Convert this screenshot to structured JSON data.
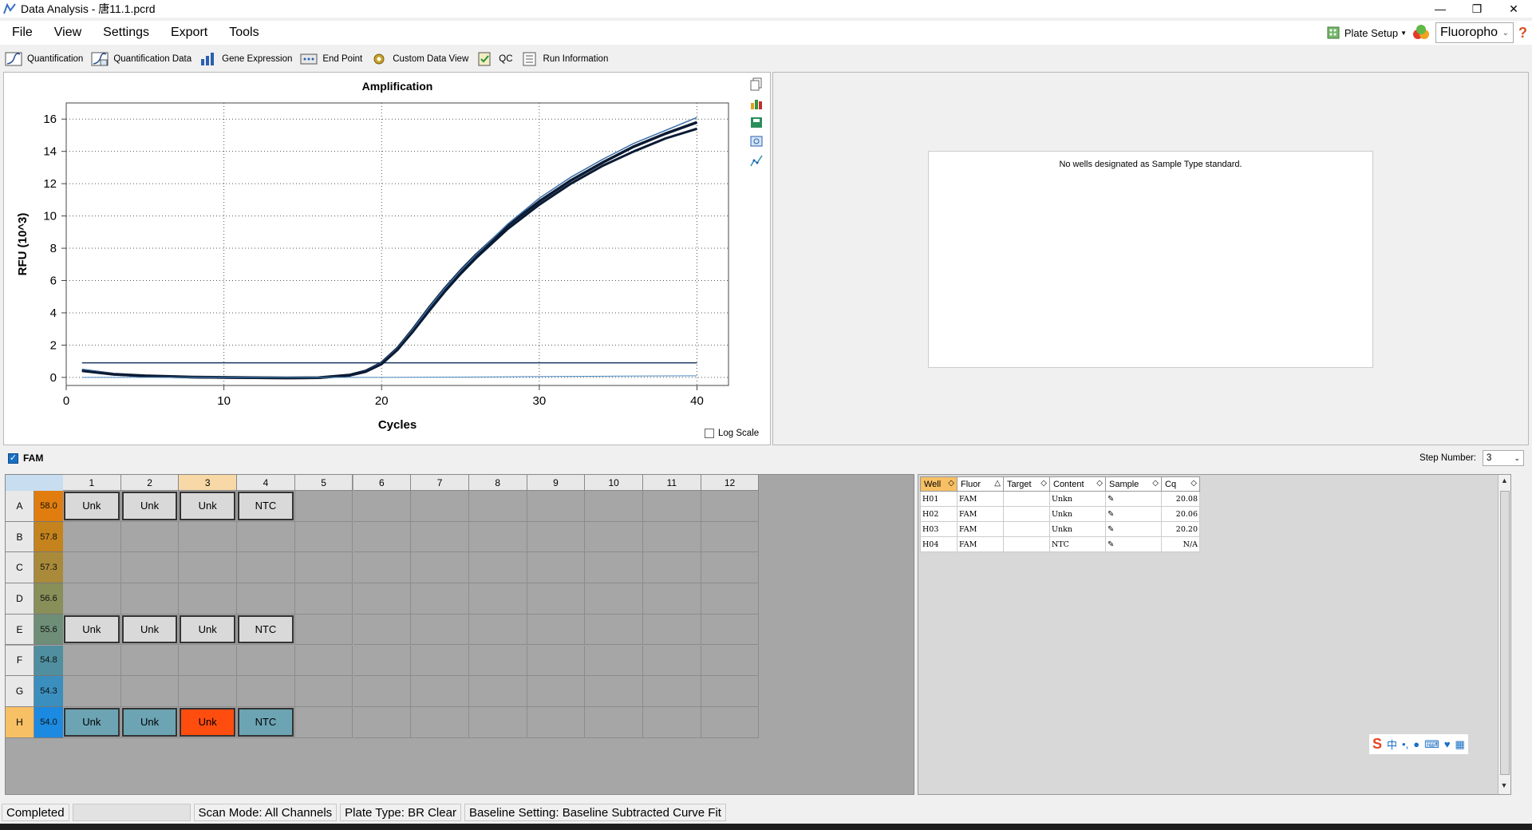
{
  "window": {
    "title": "Data Analysis - 唐11.1.pcrd"
  },
  "menu": {
    "items": [
      "File",
      "View",
      "Settings",
      "Export",
      "Tools"
    ],
    "plate_setup": "Plate Setup",
    "fluorophore": "Fluoropho"
  },
  "toolbar": {
    "tabs": [
      "Quantification",
      "Quantification Data",
      "Gene Expression",
      "End Point",
      "Custom Data View",
      "QC",
      "Run Information"
    ],
    "active": "Quantification"
  },
  "chart_data": {
    "type": "line",
    "title": "Amplification",
    "xlabel": "Cycles",
    "ylabel": "RFU (10^3)",
    "xlim": [
      0,
      42
    ],
    "ylim": [
      -0.5,
      17
    ],
    "xticks": [
      0,
      10,
      20,
      30,
      40
    ],
    "yticks": [
      0,
      2,
      4,
      6,
      8,
      10,
      12,
      14,
      16
    ],
    "grid": true,
    "threshold": 0.9,
    "series": [
      {
        "well": "H01",
        "x": [
          1,
          3,
          5,
          8,
          10,
          12,
          14,
          16,
          18,
          19,
          20,
          21,
          22,
          23,
          24,
          25,
          26,
          28,
          30,
          32,
          34,
          36,
          38,
          40
        ],
        "y": [
          0.45,
          0.2,
          0.1,
          0.02,
          0,
          -0.02,
          -0.03,
          -0.02,
          0.15,
          0.4,
          0.9,
          1.8,
          3.0,
          4.3,
          5.5,
          6.6,
          7.6,
          9.4,
          10.9,
          12.2,
          13.3,
          14.3,
          15.1,
          15.8
        ]
      },
      {
        "well": "H02",
        "x": [
          1,
          3,
          5,
          8,
          10,
          12,
          14,
          16,
          18,
          19,
          20,
          21,
          22,
          23,
          24,
          25,
          26,
          28,
          30,
          32,
          34,
          36,
          38,
          40
        ],
        "y": [
          0.5,
          0.22,
          0.1,
          0.02,
          0,
          -0.02,
          -0.03,
          -0.02,
          0.15,
          0.4,
          0.9,
          1.8,
          3.0,
          4.3,
          5.5,
          6.6,
          7.6,
          9.5,
          11.1,
          12.4,
          13.5,
          14.5,
          15.3,
          16.1
        ]
      },
      {
        "well": "H03",
        "x": [
          1,
          3,
          5,
          8,
          10,
          12,
          14,
          16,
          18,
          19,
          20,
          21,
          22,
          23,
          24,
          25,
          26,
          28,
          30,
          32,
          34,
          36,
          38,
          40
        ],
        "y": [
          0.4,
          0.18,
          0.08,
          0.01,
          -0.01,
          -0.03,
          -0.04,
          -0.03,
          0.12,
          0.35,
          0.82,
          1.7,
          2.85,
          4.1,
          5.3,
          6.4,
          7.4,
          9.2,
          10.7,
          12.0,
          13.1,
          14.0,
          14.8,
          15.4
        ]
      },
      {
        "well": "H04",
        "x": [
          1,
          10,
          20,
          25,
          30,
          35,
          40
        ],
        "y": [
          0,
          0,
          0,
          0.02,
          0.05,
          0.08,
          0.1
        ]
      }
    ]
  },
  "log_scale": "Log Scale",
  "standard": {
    "message": "No wells designated as Sample Type standard."
  },
  "fam": {
    "label": "FAM",
    "step_label": "Step Number:",
    "step_value": "3"
  },
  "plate": {
    "columns": [
      "1",
      "2",
      "3",
      "4",
      "5",
      "6",
      "7",
      "8",
      "9",
      "10",
      "11",
      "12"
    ],
    "rows": [
      {
        "label": "A",
        "temp": "58.0",
        "color": "#e07d0e"
      },
      {
        "label": "B",
        "temp": "57.8",
        "color": "#c4831c"
      },
      {
        "label": "C",
        "temp": "57.3",
        "color": "#a98a3a"
      },
      {
        "label": "D",
        "temp": "56.6",
        "color": "#888f58"
      },
      {
        "label": "E",
        "temp": "55.6",
        "color": "#6e8e78"
      },
      {
        "label": "F",
        "temp": "54.8",
        "color": "#4f8f9f"
      },
      {
        "label": "G",
        "temp": "54.3",
        "color": "#3a8fbe"
      },
      {
        "label": "H",
        "temp": "54.0",
        "color": "#1c8ae0"
      }
    ],
    "wells": [
      {
        "row": 0,
        "col": 0,
        "label": "Unk",
        "style": "gray"
      },
      {
        "row": 0,
        "col": 1,
        "label": "Unk",
        "style": "gray"
      },
      {
        "row": 0,
        "col": 2,
        "label": "Unk",
        "style": "gray"
      },
      {
        "row": 0,
        "col": 3,
        "label": "NTC",
        "style": "gray"
      },
      {
        "row": 4,
        "col": 0,
        "label": "Unk",
        "style": "gray"
      },
      {
        "row": 4,
        "col": 1,
        "label": "Unk",
        "style": "gray"
      },
      {
        "row": 4,
        "col": 2,
        "label": "Unk",
        "style": "gray"
      },
      {
        "row": 4,
        "col": 3,
        "label": "NTC",
        "style": "gray"
      },
      {
        "row": 7,
        "col": 0,
        "label": "Unk",
        "style": "blue"
      },
      {
        "row": 7,
        "col": 1,
        "label": "Unk",
        "style": "blue"
      },
      {
        "row": 7,
        "col": 2,
        "label": "Unk",
        "style": "orange"
      },
      {
        "row": 7,
        "col": 3,
        "label": "NTC",
        "style": "blue"
      }
    ]
  },
  "well_table": {
    "headers": [
      "Well",
      "Fluor",
      "Target",
      "Content",
      "Sample",
      "Cq"
    ],
    "rows": [
      [
        "H01",
        "FAM",
        "",
        "Unkn",
        "",
        "20.08"
      ],
      [
        "H02",
        "FAM",
        "",
        "Unkn",
        "",
        "20.06"
      ],
      [
        "H03",
        "FAM",
        "",
        "Unkn",
        "",
        "20.20"
      ],
      [
        "H04",
        "FAM",
        "",
        "NTC",
        "",
        "N/A"
      ]
    ]
  },
  "status": {
    "completed": "Completed",
    "scan_mode": "Scan Mode: All Channels",
    "plate_type": "Plate Type: BR Clear",
    "baseline": "Baseline Setting: Baseline Subtracted Curve Fit"
  },
  "ime": {
    "label": "中"
  }
}
